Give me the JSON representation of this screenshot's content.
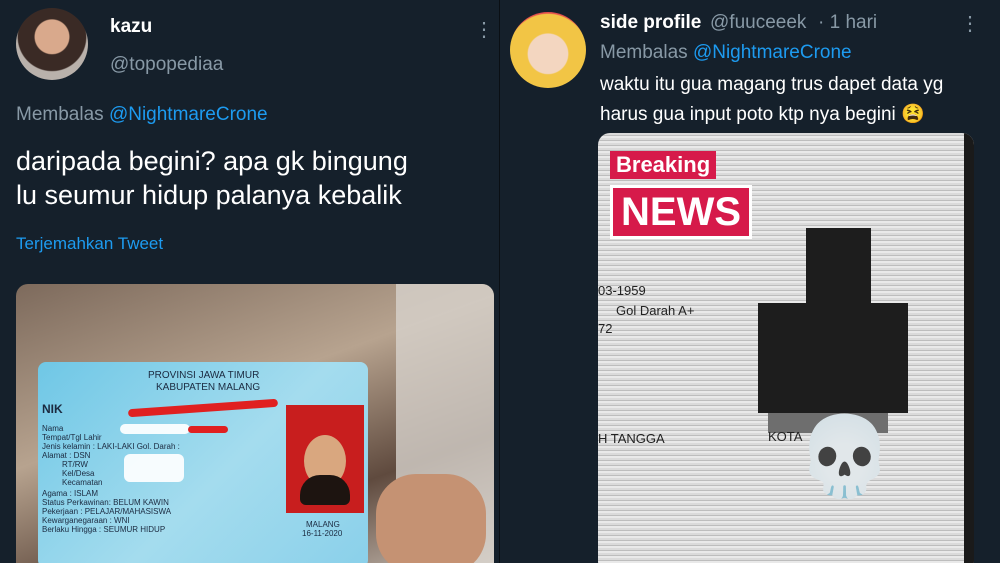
{
  "left_tweet": {
    "name": "kazu",
    "handle": "@topopediaa",
    "reply_prefix": "Membalas",
    "reply_mention": "@NightmareCrone",
    "text_line1": "daripada begini? apa gk bingung",
    "text_line2": "lu seumur hidup palanya kebalik",
    "translate_label": "Terjemahkan Tweet",
    "more_icon": "more-vertical-icon",
    "card": {
      "province": "PROVINSI JAWA TIMUR",
      "regency": "KABUPATEN MALANG",
      "nik_label": "NIK",
      "rows": [
        "Nama",
        "Tempat/Tgl Lahir",
        "Jenis kelamin  : LAKI-LAKI      Gol. Darah :",
        "Alamat          : DSN",
        "RT/RW",
        "Kel/Desa",
        "Kecamatan",
        "Agama              : ISLAM",
        "Status Perkawinan: BELUM KAWIN",
        "Pekerjaan          : PELAJAR/MAHASISWA",
        "Kewarganegaraan : WNI",
        "Berlaku Hingga    : SEUMUR HIDUP"
      ],
      "city": "MALANG",
      "date": "16-11-2020"
    }
  },
  "right_tweet": {
    "name": "side profile",
    "handle": "@fuuceeek",
    "time": "· 1 hari",
    "reply_prefix": "Membalas",
    "reply_mention": "@NightmareCrone",
    "text_line1": "waktu itu gua magang trus dapet data yg",
    "text_line2": "harus gua input poto ktp nya begini 😫",
    "more_icon": "more-vertical-icon",
    "screen": {
      "breaking": "Breaking",
      "news": "NEWS",
      "dob_fragment": "03-1959",
      "gol_darah": "Gol Darah    A+",
      "number_fragment": "72",
      "job_fragment": "H TANGGA",
      "city_fragment": "KOTA",
      "skull": "💀"
    }
  },
  "colors": {
    "background": "#15202b",
    "secondary_text": "#8899a6",
    "link": "#1d9bf0",
    "news_red": "#d61a4a"
  }
}
